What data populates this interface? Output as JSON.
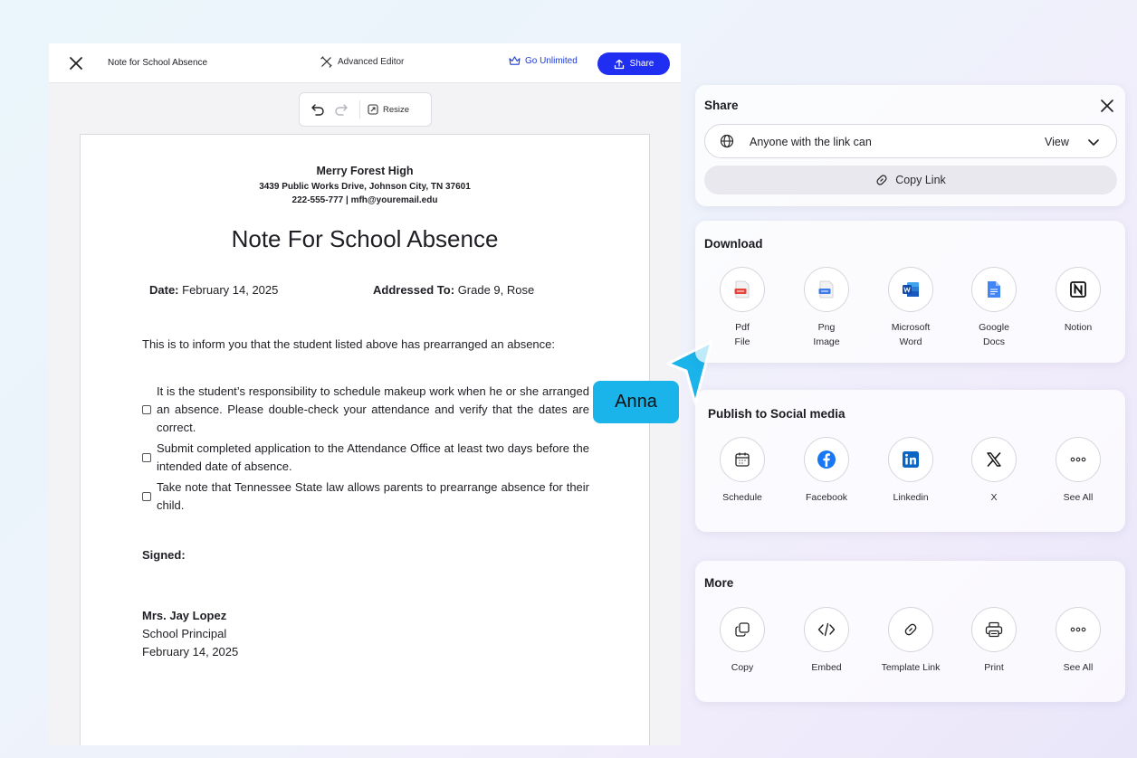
{
  "editor": {
    "doc_title": "Note for School Absence",
    "advanced_label": "Advanced Editor",
    "unlimited_label": "Go Unlimited",
    "share_label": "Share",
    "resize_label": "Resize"
  },
  "document": {
    "school": "Merry Forest High",
    "address": "3439 Public Works Drive, Johnson City, TN 37601",
    "contact": "222-555-777 | mfh@youremail.edu",
    "heading": "Note For School Absence",
    "date_label": "Date:",
    "date_value": "February 14, 2025",
    "addressed_label": "Addressed To:",
    "addressed_value": "Grade 9, Rose",
    "intro": "This is to inform you that the student listed above has prearranged an absence:",
    "items": [
      "It is the student’s responsibility to schedule makeup work when he or she arranged an absence. Please double-check your attendance and verify that the dates are correct.",
      "Submit completed application to the Attendance Office at least two days before the intended date of absence.",
      "Take note that Tennessee State law allows parents to prearrange absence for their child."
    ],
    "signed_label": "Signed:",
    "signer_name": "Mrs. Jay Lopez",
    "signer_role": "School Principal",
    "signed_date": "February 14, 2025"
  },
  "collaborator": {
    "name": "Anna",
    "color": "#1ab3ea"
  },
  "share": {
    "title": "Share",
    "link_access_label": "Anyone with the link can",
    "link_access_value": "View",
    "copy_link_label": "Copy Link"
  },
  "download": {
    "title": "Download",
    "options": [
      {
        "line1": "Pdf",
        "line2": "File",
        "icon": "pdf-file-icon"
      },
      {
        "line1": "Png",
        "line2": "Image",
        "icon": "png-image-icon"
      },
      {
        "line1": "Microsoft",
        "line2": "Word",
        "icon": "microsoft-word-icon"
      },
      {
        "line1": "Google",
        "line2": "Docs",
        "icon": "google-docs-icon"
      },
      {
        "line1": "Notion",
        "line2": "",
        "icon": "notion-icon"
      }
    ]
  },
  "social": {
    "title": "Publish to Social media",
    "options": [
      {
        "label": "Schedule",
        "icon": "calendar-icon"
      },
      {
        "label": "Facebook",
        "icon": "facebook-icon"
      },
      {
        "label": "Linkedin",
        "icon": "linkedin-icon"
      },
      {
        "label": "X",
        "icon": "x-logo-icon"
      },
      {
        "label": "See All",
        "icon": "more-dots-icon"
      }
    ]
  },
  "more": {
    "title": "More",
    "options": [
      {
        "label": "Copy",
        "icon": "copy-icon"
      },
      {
        "label": "Embed",
        "icon": "embed-code-icon"
      },
      {
        "label": "Template Link",
        "icon": "link-icon"
      },
      {
        "label": "Print",
        "icon": "printer-icon"
      },
      {
        "label": "See All",
        "icon": "more-dots-icon"
      }
    ]
  },
  "colors": {
    "accent": "#1f2ef0",
    "link": "#1d3bd8",
    "facebook": "#1877f2",
    "linkedin": "#0a66c2"
  }
}
